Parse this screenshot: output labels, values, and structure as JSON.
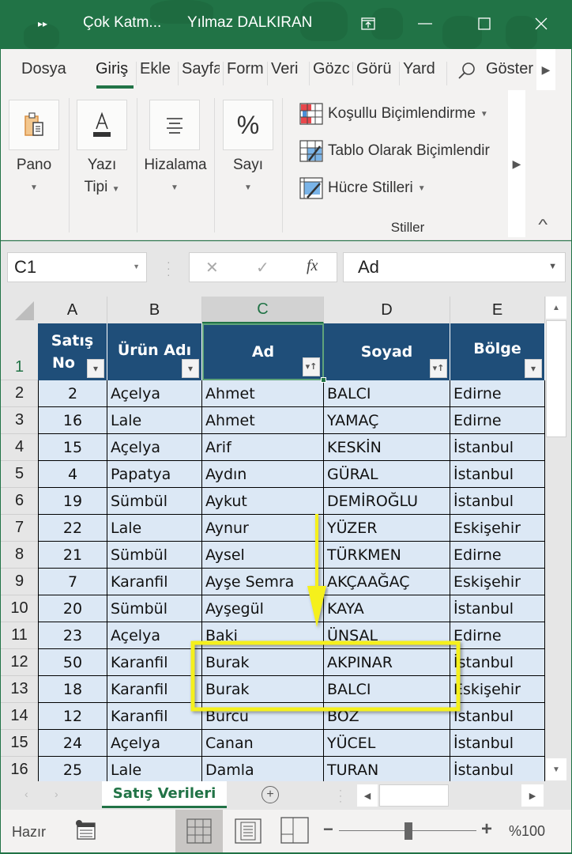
{
  "titlebar": {
    "file_name": "Çok Katm...",
    "user_name": "Yılmaz DALKIRAN",
    "qat_icon": "more-commands-icon",
    "restore_ribbon_icon": "ribbon-display-icon",
    "minimize_glyph": "—",
    "maximize_glyph": "☐",
    "close_glyph": "✕"
  },
  "tabs": [
    {
      "label": "Dosya"
    },
    {
      "label": "Giriş",
      "active": true
    },
    {
      "label": "Ekle"
    },
    {
      "label": "Sayfa"
    },
    {
      "label": "Form"
    },
    {
      "label": "Veri"
    },
    {
      "label": "Gözc"
    },
    {
      "label": "Görü"
    },
    {
      "label": "Yard"
    }
  ],
  "tell_me": {
    "label": "Göster",
    "icon": "search-icon"
  },
  "ribbon": {
    "groups": [
      {
        "label_line1": "Pano",
        "label_line2": "",
        "icon": "clipboard-icon"
      },
      {
        "label_line1": "Yazı",
        "label_line2": "Tipi",
        "icon": "font-icon"
      },
      {
        "label_line1": "Hizalama",
        "label_line2": "",
        "icon": "align-icon"
      },
      {
        "label_line1": "Sayı",
        "label_line2": "",
        "icon": "percent-icon",
        "glyph": "%"
      }
    ],
    "styles": {
      "items": [
        {
          "label": "Koşullu Biçimlendirme",
          "icon": "conditional-formatting-icon"
        },
        {
          "label": "Tablo Olarak Biçimlendir",
          "icon": "format-as-table-icon"
        },
        {
          "label": "Hücre Stilleri",
          "icon": "cell-styles-icon"
        }
      ],
      "group_label": "Stiller"
    }
  },
  "formula_bar": {
    "name_box": "C1",
    "cancel_glyph": "✕",
    "enter_glyph": "✓",
    "fx_label": "fx",
    "content": "Ad"
  },
  "grid": {
    "columns": [
      "A",
      "B",
      "C",
      "D",
      "E"
    ],
    "selected_column": "C",
    "header_row_number": "1",
    "headers": [
      {
        "line1": "Satış",
        "line2": "No",
        "filter": "dropdown"
      },
      {
        "line1": "Ürün Adı",
        "line2": "",
        "filter": "dropdown"
      },
      {
        "line1": "Ad",
        "line2": "",
        "filter": "sorted-ascending"
      },
      {
        "line1": "Soyad",
        "line2": "",
        "filter": "sorted-ascending"
      },
      {
        "line1": "Bölge",
        "line2": "",
        "filter": "dropdown"
      }
    ],
    "rows": [
      {
        "row": "2",
        "cells": [
          "2",
          "Açelya",
          "Ahmet",
          "BALCI",
          "Edirne"
        ]
      },
      {
        "row": "3",
        "cells": [
          "16",
          "Lale",
          "Ahmet",
          "YAMAÇ",
          "Edirne"
        ]
      },
      {
        "row": "4",
        "cells": [
          "15",
          "Açelya",
          "Arif",
          "KESKİN",
          "İstanbul"
        ]
      },
      {
        "row": "5",
        "cells": [
          "4",
          "Papatya",
          "Aydın",
          "GÜRAL",
          "İstanbul"
        ]
      },
      {
        "row": "6",
        "cells": [
          "19",
          "Sümbül",
          "Aykut",
          "DEMİROĞLU",
          "İstanbul"
        ]
      },
      {
        "row": "7",
        "cells": [
          "22",
          "Lale",
          "Aynur",
          "YÜZER",
          "Eskişehir"
        ]
      },
      {
        "row": "8",
        "cells": [
          "21",
          "Sümbül",
          "Aysel",
          "TÜRKMEN",
          "Edirne"
        ]
      },
      {
        "row": "9",
        "cells": [
          "7",
          "Karanfil",
          "Ayşe Semra",
          "AKÇAAĞAÇ",
          "Eskişehir"
        ]
      },
      {
        "row": "10",
        "cells": [
          "20",
          "Sümbül",
          "Ayşegül",
          "KAYA",
          "İstanbul"
        ]
      },
      {
        "row": "11",
        "cells": [
          "23",
          "Açelya",
          "Baki",
          "ÜNSAL",
          "Edirne"
        ]
      },
      {
        "row": "12",
        "cells": [
          "50",
          "Karanfil",
          "Burak",
          "AKPINAR",
          "İstanbul"
        ]
      },
      {
        "row": "13",
        "cells": [
          "18",
          "Karanfil",
          "Burak",
          "BALCI",
          "Eskişehir"
        ]
      },
      {
        "row": "14",
        "cells": [
          "12",
          "Karanfil",
          "Burcu",
          "BOZ",
          "İstanbul"
        ]
      },
      {
        "row": "15",
        "cells": [
          "24",
          "Açelya",
          "Canan",
          "YÜCEL",
          "İstanbul"
        ]
      },
      {
        "row": "16",
        "cells": [
          "25",
          "Lale",
          "Damla",
          "TURAN",
          "İstanbul"
        ]
      }
    ],
    "annotation": {
      "type": "highlight-box-with-arrow",
      "highlighted_rows": [
        "12",
        "13"
      ],
      "highlighted_columns": [
        "C",
        "D"
      ],
      "color": "#f5f01e"
    }
  },
  "sheet_tabs": {
    "active": "Satış Verileri",
    "add_glyph": "+"
  },
  "status_bar": {
    "status": "Hazır",
    "zoom_level": "%100",
    "zoom_fraction": 0.5,
    "minus_glyph": "−",
    "plus_glyph": "+"
  },
  "colors": {
    "accent": "#217346",
    "header_fill": "#1f4e79",
    "row_fill": "#dce8f5",
    "annotation": "#f5f01e"
  }
}
